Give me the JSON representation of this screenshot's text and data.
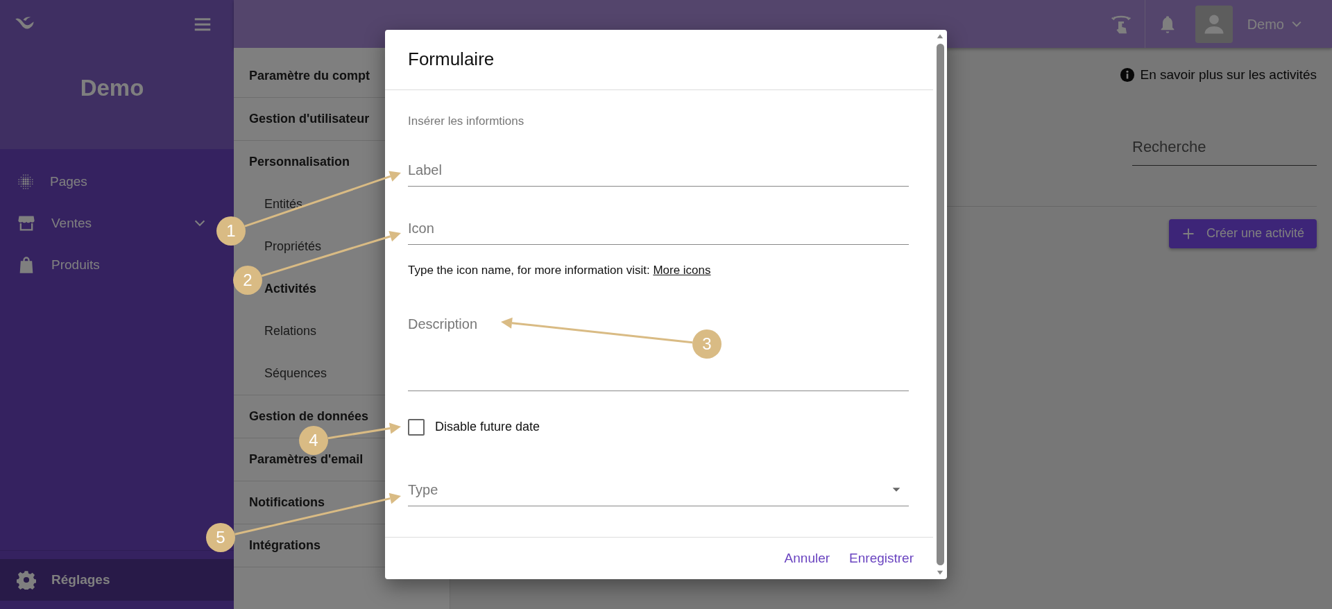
{
  "sidebar": {
    "brand": "Demo",
    "items": [
      {
        "label": "Pages",
        "has_submenu": false,
        "selected": false
      },
      {
        "label": "Ventes",
        "has_submenu": true,
        "selected": false
      },
      {
        "label": "Produits",
        "has_submenu": false,
        "selected": false
      }
    ],
    "footer_item": {
      "label": "Réglages",
      "selected": true
    }
  },
  "topbar": {
    "user": "Demo"
  },
  "settings_menu": [
    {
      "label": "Paramètre du compt"
    },
    {
      "label": "Gestion d'utilisateur"
    },
    {
      "label": "Personnalisation",
      "children": [
        {
          "label": "Entités",
          "selected": false
        },
        {
          "label": "Propriétés",
          "selected": false
        },
        {
          "label": "Activités",
          "selected": true
        },
        {
          "label": "Relations",
          "selected": false
        },
        {
          "label": "Séquences",
          "selected": false
        }
      ]
    },
    {
      "label": "Gestion de données"
    },
    {
      "label": "Paramètres d'email"
    },
    {
      "label": "Notifications"
    },
    {
      "label": "Intégrations"
    }
  ],
  "content": {
    "info_link": "En savoir plus sur les activités",
    "search": {
      "placeholder": "Recherche"
    },
    "create_button": "Créer une activité"
  },
  "dialog": {
    "title": "Formulaire",
    "subtitle": "Insérer les informtions",
    "fields": [
      {
        "kind": "text",
        "placeholder": "Label"
      },
      {
        "kind": "text",
        "placeholder": "Icon",
        "helper": "Type the icon name, for more information visit:",
        "helper_link": "More icons"
      },
      {
        "kind": "textarea",
        "placeholder": "Description"
      },
      {
        "kind": "checkbox",
        "label": "Disable future date",
        "checked": false
      },
      {
        "kind": "select",
        "placeholder": "Type"
      }
    ],
    "buttons": [
      "Annuler",
      "Enregistrer"
    ]
  },
  "callouts": [
    "1",
    "2",
    "3",
    "4",
    "5"
  ]
}
